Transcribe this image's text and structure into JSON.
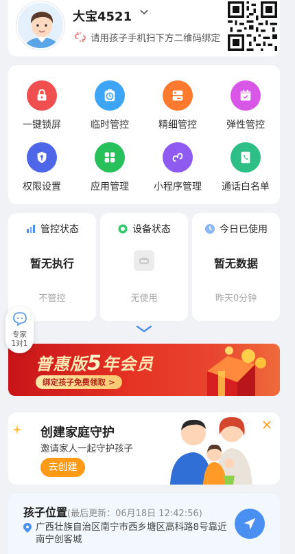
{
  "header": {
    "child_name": "大宝4521",
    "bind_hint": "请用孩子手机扫下方二维码绑定"
  },
  "quick_actions": [
    {
      "label": "一键锁屏",
      "icon": "lock-icon",
      "color": "#f04f4f"
    },
    {
      "label": "临时管控",
      "icon": "timer-icon",
      "color": "#3da5f5"
    },
    {
      "label": "精细管控",
      "icon": "control-panel-icon",
      "color": "#ff7a2e"
    },
    {
      "label": "弹性管控",
      "icon": "calendar-icon",
      "color": "#d957e6"
    },
    {
      "label": "权限设置",
      "icon": "shield-key-icon",
      "color": "#4e67e8"
    },
    {
      "label": "应用管理",
      "icon": "apps-grid-icon",
      "color": "#28c05a"
    },
    {
      "label": "小程序管理",
      "icon": "mini-program-icon",
      "color": "#8f5af0"
    },
    {
      "label": "通话白名单",
      "icon": "phone-book-icon",
      "color": "#2dbf86"
    }
  ],
  "status": {
    "control": {
      "title": "管控状态",
      "main": "暂无执行",
      "sub": "不管控"
    },
    "device": {
      "title": "设备状态",
      "main": "",
      "sub": "无使用"
    },
    "usage": {
      "title": "今日已使用",
      "main": "暂无数据",
      "sub": "昨天0分钟"
    }
  },
  "expert": {
    "line1": "专家",
    "line2": "1对1"
  },
  "vip_banner": {
    "title_pre": "普惠版",
    "title_num": "5",
    "title_post": "年会员",
    "button": "绑定孩子免费领取 >"
  },
  "family": {
    "title": "创建家庭守护",
    "subtitle": "邀请家人一起守护孩子",
    "button": "去创建"
  },
  "location": {
    "title": "孩子位置",
    "updated": "(最后更新：06月18日 12:42:56)",
    "address": "广西壮族自治区南宁市西乡塘区高科路8号靠近南宁创客城"
  },
  "colors": {
    "accent_blue": "#4a8ff2",
    "orange": "#ff9a16",
    "banner_red": "#e53224"
  }
}
